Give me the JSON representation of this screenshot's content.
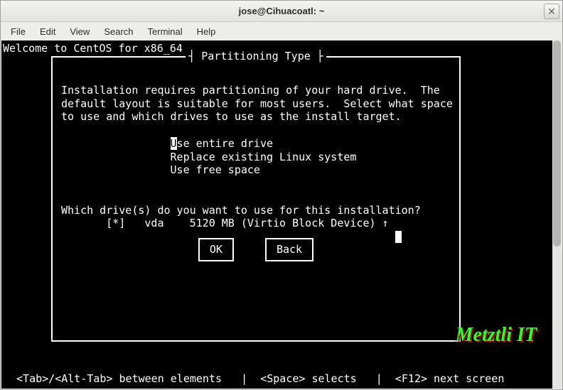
{
  "window": {
    "title": "jose@Cihuacoatl: ~"
  },
  "menu": {
    "file": "File",
    "edit": "Edit",
    "view": "View",
    "search": "Search",
    "terminal": "Terminal",
    "help": "Help"
  },
  "welcome": "Welcome to CentOS for x86_64",
  "dialog": {
    "title": "Partitioning Type",
    "body1": "Installation requires partitioning of your hard drive.  The",
    "body2": "default layout is suitable for most users.  Select what space",
    "body3": "to use and which drives to use as the install target.",
    "opt1_first": "U",
    "opt1_rest": "se entire drive",
    "opt2": "Replace existing Linux system",
    "opt3": "Use free space",
    "prompt": "Which drive(s) do you want to use for this installation?",
    "drive": "[*]   vda    5120 MB (Virtio Block Device) ↑",
    "ok": "OK",
    "back": "Back"
  },
  "footer": " <Tab>/<Alt-Tab> between elements   |  <Space> selects   |  <F12> next screen",
  "brand": "Metztli IT"
}
